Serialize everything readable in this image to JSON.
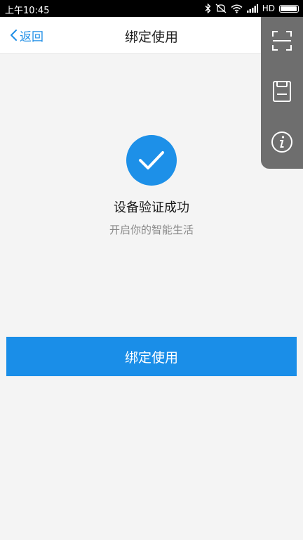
{
  "status_bar": {
    "time": "上午10:45",
    "network_label": "HD",
    "icons": [
      "bluetooth-icon",
      "mute-icon",
      "wifi-icon",
      "signal-icon",
      "battery-icon"
    ],
    "battery_level": 0.95
  },
  "nav": {
    "back_label": "返回",
    "title": "绑定使用"
  },
  "float_panel": {
    "items": [
      "scan-icon",
      "save-icon",
      "info-icon"
    ]
  },
  "result": {
    "title": "设备验证成功",
    "subtitle": "开启你的智能生活"
  },
  "action": {
    "bind_label": "绑定使用"
  },
  "colors": {
    "accent": "#1a8ee8",
    "panel": "#6e6e6e",
    "background": "#f4f4f4"
  }
}
